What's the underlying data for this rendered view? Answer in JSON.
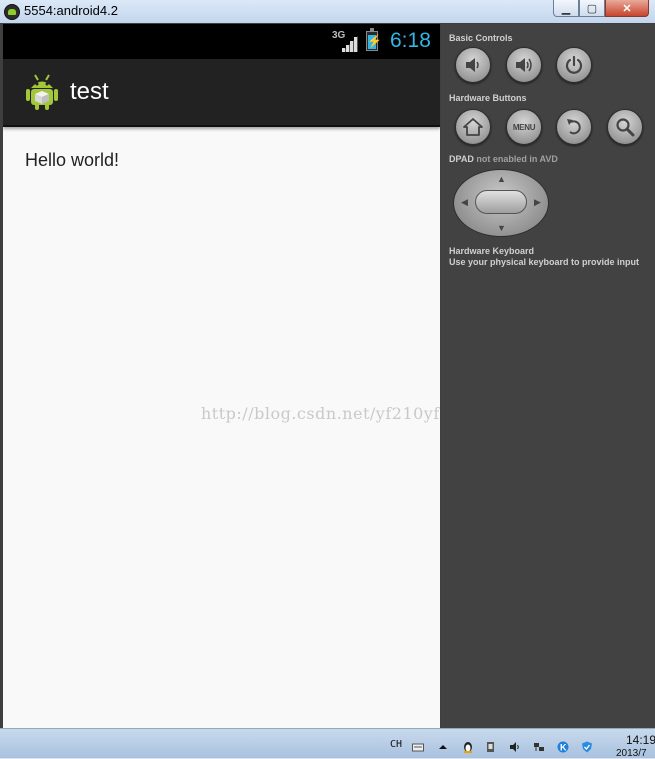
{
  "window": {
    "title": "5554:android4.2"
  },
  "statusbar": {
    "network": "3G",
    "time": "6:18"
  },
  "app": {
    "name": "test",
    "body_text": "Hello world!"
  },
  "watermark": "http://blog.csdn.net/yf210yf",
  "panel": {
    "basic_controls_label": "Basic Controls",
    "hardware_buttons_label": "Hardware Buttons",
    "menu_button_label": "MENU",
    "dpad_label": "DPAD",
    "dpad_status": "not enabled in AVD",
    "keyboard_label": "Hardware Keyboard",
    "keyboard_hint": "Use your physical keyboard to provide input"
  },
  "taskbar": {
    "language": "CH",
    "time": "14:19",
    "date": "2013/7"
  },
  "colors": {
    "accent": "#33b5e5",
    "android_green": "#a4c639"
  }
}
